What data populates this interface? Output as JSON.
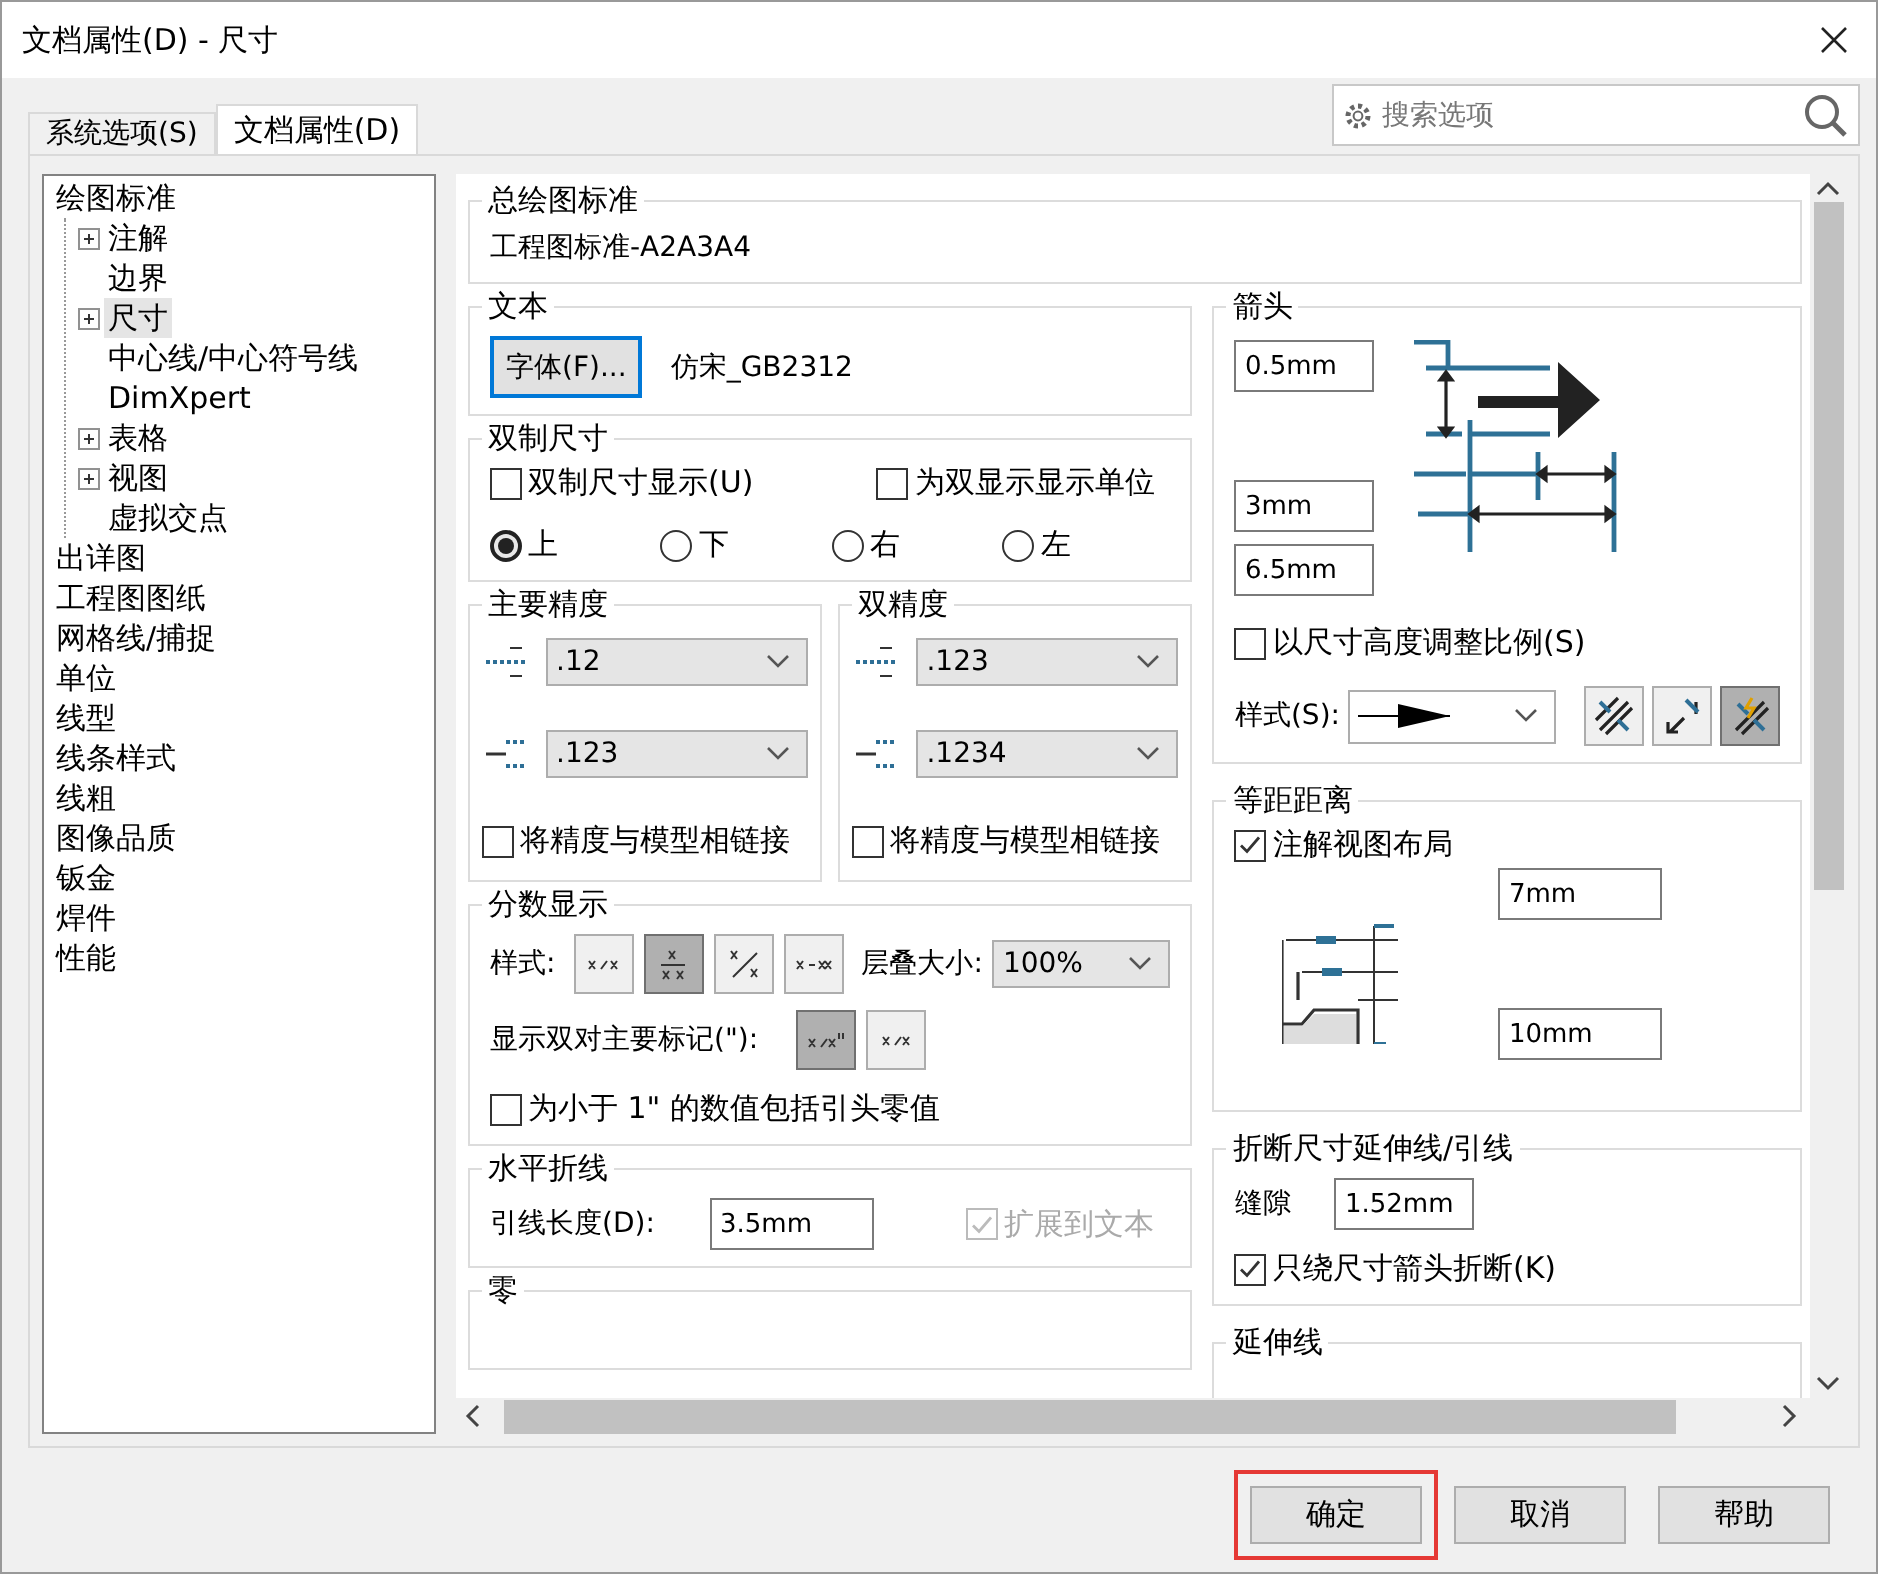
{
  "window": {
    "title": "文档属性(D) - 尺寸"
  },
  "tabs": [
    {
      "label": "系统选项(S)",
      "selected": false
    },
    {
      "label": "文档属性(D)",
      "selected": true
    }
  ],
  "search": {
    "placeholder": "搜索选项"
  },
  "tree": [
    {
      "label": "绘图标准",
      "expandable": false,
      "selected": false,
      "children": [
        {
          "label": "注解",
          "expandable": true,
          "selected": false
        },
        {
          "label": "边界",
          "expandable": false,
          "selected": false
        },
        {
          "label": "尺寸",
          "expandable": true,
          "selected": true
        },
        {
          "label": "中心线/中心符号线",
          "expandable": false,
          "selected": false
        },
        {
          "label": "DimXpert",
          "expandable": false,
          "selected": false
        },
        {
          "label": "表格",
          "expandable": true,
          "selected": false
        },
        {
          "label": "视图",
          "expandable": true,
          "selected": false
        },
        {
          "label": "虚拟交点",
          "expandable": false,
          "selected": false
        }
      ]
    },
    {
      "label": "出详图",
      "expandable": false,
      "selected": false
    },
    {
      "label": "工程图图纸",
      "expandable": false,
      "selected": false
    },
    {
      "label": "网格线/捕捉",
      "expandable": false,
      "selected": false
    },
    {
      "label": "单位",
      "expandable": false,
      "selected": false
    },
    {
      "label": "线型",
      "expandable": false,
      "selected": false
    },
    {
      "label": "线条样式",
      "expandable": false,
      "selected": false
    },
    {
      "label": "线粗",
      "expandable": false,
      "selected": false
    },
    {
      "label": "图像品质",
      "expandable": false,
      "selected": false
    },
    {
      "label": "钣金",
      "expandable": false,
      "selected": false
    },
    {
      "label": "焊件",
      "expandable": false,
      "selected": false
    },
    {
      "label": "性能",
      "expandable": false,
      "selected": false
    }
  ],
  "general_standard": {
    "title": "总绘图标准",
    "value": "工程图标准-A2A3A4"
  },
  "text": {
    "title": "文本",
    "font_button": "字体(F)...",
    "font_name": "仿宋_GB2312"
  },
  "dual_dimensions": {
    "title": "双制尺寸",
    "checkboxes": [
      {
        "label": "双制尺寸显示(U)",
        "checked": false
      },
      {
        "label": "为双显示显示单位",
        "checked": false
      }
    ],
    "positions": [
      {
        "label": "上",
        "selected": true
      },
      {
        "label": "下",
        "selected": false
      },
      {
        "label": "右",
        "selected": false
      },
      {
        "label": "左",
        "selected": false
      }
    ]
  },
  "precision": [
    {
      "title": "主要精度",
      "value": ".12",
      "tolerance": ".123",
      "link": {
        "label": "将精度与模型相链接",
        "checked": false
      }
    },
    {
      "title": "双精度",
      "value": ".123",
      "tolerance": ".1234",
      "link": {
        "label": "将精度与模型相链接",
        "checked": false
      }
    }
  ],
  "fraction": {
    "title": "分数显示",
    "style_label": "样式:",
    "styles": [
      {
        "kind": "slash",
        "selected": false
      },
      {
        "kind": "stacked",
        "selected": true
      },
      {
        "kind": "diagonal",
        "selected": false
      },
      {
        "kind": "dash",
        "selected": false
      }
    ],
    "stack_size_label": "层叠大小:",
    "stack_size": "100%",
    "marks_label": "显示双对主要标记(\"):",
    "marks": [
      {
        "kind": "with-marks",
        "selected": true
      },
      {
        "kind": "plain",
        "selected": false
      }
    ],
    "leading_zero": {
      "label": "为小于 1\" 的数值包括引头零值",
      "checked": false
    }
  },
  "horizontal_leader": {
    "title": "水平折线",
    "length_label": "引线长度(D):",
    "length": "3.5mm",
    "extend": {
      "label": "扩展到文本",
      "checked": true,
      "disabled": true
    }
  },
  "zero": {
    "title": "零"
  },
  "arrows": {
    "title": "箭头",
    "sizes": [
      "0.5mm",
      "3mm",
      "6.5mm"
    ],
    "scale": {
      "label": "以尺寸高度调整比例(S)",
      "checked": false
    },
    "style_label": "样式(S):",
    "placement": [
      {
        "kind": "inside",
        "selected": false
      },
      {
        "kind": "outside",
        "selected": false
      },
      {
        "kind": "smart",
        "selected": true
      }
    ]
  },
  "offset": {
    "title": "等距距离",
    "layout": {
      "label": "注解视图布局",
      "checked": true
    },
    "distances": [
      "7mm",
      "10mm"
    ]
  },
  "break_lines": {
    "title": "折断尺寸延伸线/引线",
    "gap_label": "缝隙",
    "gap": "1.52mm",
    "arrow_only": {
      "label": "只绕尺寸箭头折断(K)",
      "checked": true
    }
  },
  "extension_lines": {
    "title": "延伸线"
  },
  "buttons": [
    {
      "label": "确定",
      "highlighted": true
    },
    {
      "label": "取消",
      "highlighted": false
    },
    {
      "label": "帮助",
      "highlighted": false
    }
  ]
}
